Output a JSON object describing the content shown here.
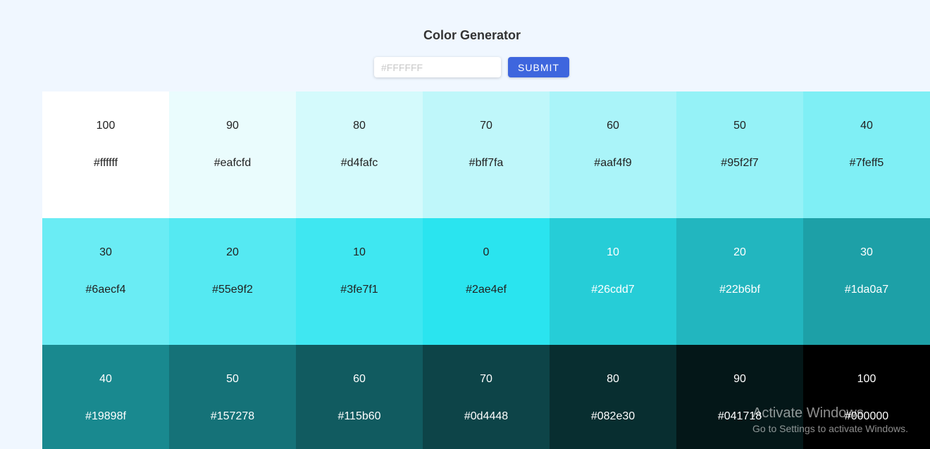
{
  "header": {
    "title": "Color Generator"
  },
  "form": {
    "placeholder": "#FFFFFF",
    "value": "",
    "submit_label": "SUBMIT"
  },
  "swatches": [
    {
      "weight": "100",
      "hex": "#ffffff",
      "light_text": false
    },
    {
      "weight": "90",
      "hex": "#eafcfd",
      "light_text": false
    },
    {
      "weight": "80",
      "hex": "#d4fafc",
      "light_text": false
    },
    {
      "weight": "70",
      "hex": "#bff7fa",
      "light_text": false
    },
    {
      "weight": "60",
      "hex": "#aaf4f9",
      "light_text": false
    },
    {
      "weight": "50",
      "hex": "#95f2f7",
      "light_text": false
    },
    {
      "weight": "40",
      "hex": "#7feff5",
      "light_text": false
    },
    {
      "weight": "30",
      "hex": "#6aecf4",
      "light_text": false
    },
    {
      "weight": "20",
      "hex": "#55e9f2",
      "light_text": false
    },
    {
      "weight": "10",
      "hex": "#3fe7f1",
      "light_text": false
    },
    {
      "weight": "0",
      "hex": "#2ae4ef",
      "light_text": false
    },
    {
      "weight": "10",
      "hex": "#26cdd7",
      "light_text": true
    },
    {
      "weight": "20",
      "hex": "#22b6bf",
      "light_text": true
    },
    {
      "weight": "30",
      "hex": "#1da0a7",
      "light_text": true
    },
    {
      "weight": "40",
      "hex": "#19898f",
      "light_text": true
    },
    {
      "weight": "50",
      "hex": "#157278",
      "light_text": true
    },
    {
      "weight": "60",
      "hex": "#115b60",
      "light_text": true
    },
    {
      "weight": "70",
      "hex": "#0d4448",
      "light_text": true
    },
    {
      "weight": "80",
      "hex": "#082e30",
      "light_text": true
    },
    {
      "weight": "90",
      "hex": "#041718",
      "light_text": true
    },
    {
      "weight": "100",
      "hex": "#000000",
      "light_text": true
    }
  ],
  "colors": {
    "dark_text": "#222222",
    "light_text": "#ffffff",
    "button": "#3e66de",
    "background": "#f0f7ff"
  },
  "watermark": {
    "title": "Activate Windows",
    "subtitle": "Go to Settings to activate Windows."
  }
}
